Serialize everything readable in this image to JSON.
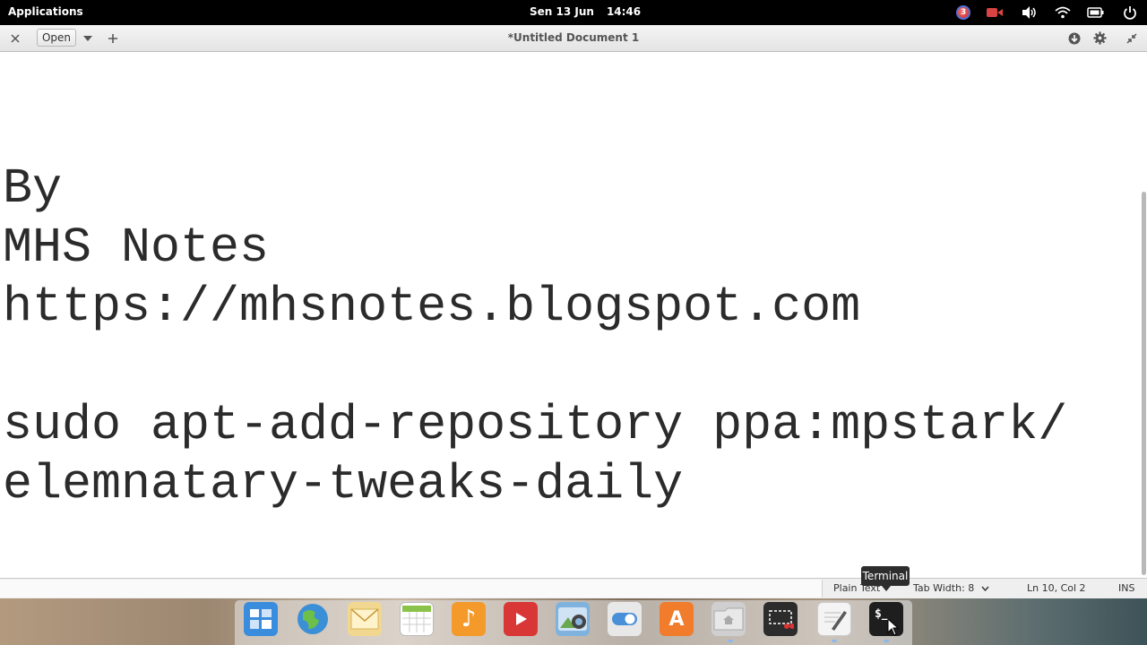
{
  "panel": {
    "applications_label": "Applications",
    "date": "Sen 13 Jun",
    "time": "14:46",
    "notification_count": "3"
  },
  "header": {
    "open_label": "Open",
    "document_title": "*Untitled Document 1"
  },
  "editor": {
    "content": "By\nMHS Notes\nhttps://mhsnotes.blogspot.com\n\nsudo apt-add-repository ppa:mpstark/\nelemnatary-tweaks-daily"
  },
  "statusbar": {
    "language": "Plain Text",
    "tab_width": "Tab Width: 8",
    "position": "Ln 10, Col 2",
    "mode": "INS"
  },
  "dock": {
    "tooltip": "Terminal",
    "terminal_glyph": "$_",
    "icons": [
      "multitasking-view-icon",
      "web-browser-icon",
      "mail-icon",
      "calendar-icon",
      "music-icon",
      "videos-icon",
      "photos-icon",
      "system-settings-icon",
      "app-center-icon",
      "files-icon",
      "screenshot-icon",
      "text-editor-icon",
      "terminal-icon"
    ]
  },
  "colors": {
    "panel_bg": "#000000",
    "editor_bg": "#ffffff",
    "text": "#2b2b2b",
    "badge": "#d32f2f"
  }
}
